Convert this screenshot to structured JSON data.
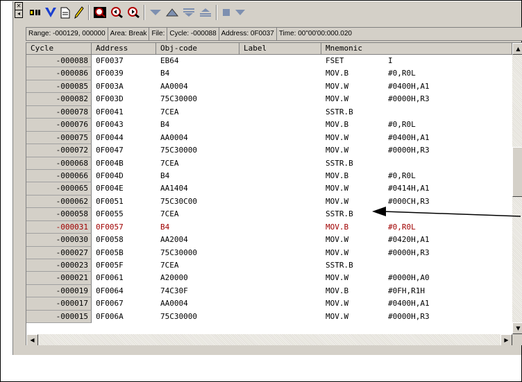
{
  "range_bar": {
    "range": "Range: -000129, 000000",
    "area": "Area: Break",
    "file": "File:",
    "cycle": "Cycle: -000088",
    "address": "Address: 0F0037",
    "time": "Time: 00\"00'00:000.020"
  },
  "columns": [
    "Cycle",
    "Address",
    "Obj-code",
    "Label",
    "Mnemonic"
  ],
  "rows": [
    {
      "cycle": "-000088",
      "address": "0F0037",
      "obj": "EB64",
      "label": "",
      "mnemonic": "FSET",
      "operand": "I"
    },
    {
      "cycle": "-000086",
      "address": "0F0039",
      "obj": "B4",
      "label": "",
      "mnemonic": "MOV.B",
      "operand": "#0,R0L"
    },
    {
      "cycle": "-000085",
      "address": "0F003A",
      "obj": "AA0004",
      "label": "",
      "mnemonic": "MOV.W",
      "operand": "#0400H,A1"
    },
    {
      "cycle": "-000082",
      "address": "0F003D",
      "obj": "75C30000",
      "label": "",
      "mnemonic": "MOV.W",
      "operand": "#0000H,R3"
    },
    {
      "cycle": "-000078",
      "address": "0F0041",
      "obj": "7CEA",
      "label": "",
      "mnemonic": "SSTR.B",
      "operand": ""
    },
    {
      "cycle": "-000076",
      "address": "0F0043",
      "obj": "B4",
      "label": "",
      "mnemonic": "MOV.B",
      "operand": "#0,R0L"
    },
    {
      "cycle": "-000075",
      "address": "0F0044",
      "obj": "AA0004",
      "label": "",
      "mnemonic": "MOV.W",
      "operand": "#0400H,A1"
    },
    {
      "cycle": "-000072",
      "address": "0F0047",
      "obj": "75C30000",
      "label": "",
      "mnemonic": "MOV.W",
      "operand": "#0000H,R3"
    },
    {
      "cycle": "-000068",
      "address": "0F004B",
      "obj": "7CEA",
      "label": "",
      "mnemonic": "SSTR.B",
      "operand": ""
    },
    {
      "cycle": "-000066",
      "address": "0F004D",
      "obj": "B4",
      "label": "",
      "mnemonic": "MOV.B",
      "operand": "#0,R0L"
    },
    {
      "cycle": "-000065",
      "address": "0F004E",
      "obj": "AA1404",
      "label": "",
      "mnemonic": "MOV.W",
      "operand": "#0414H,A1"
    },
    {
      "cycle": "-000062",
      "address": "0F0051",
      "obj": "75C30C00",
      "label": "",
      "mnemonic": "MOV.W",
      "operand": "#000CH,R3"
    },
    {
      "cycle": "-000058",
      "address": "0F0055",
      "obj": "7CEA",
      "label": "",
      "mnemonic": "SSTR.B",
      "operand": ""
    },
    {
      "cycle": "-000031",
      "address": "0F0057",
      "obj": "B4",
      "label": "",
      "mnemonic": "MOV.B",
      "operand": "#0,R0L",
      "highlight": true
    },
    {
      "cycle": "-000030",
      "address": "0F0058",
      "obj": "AA2004",
      "label": "",
      "mnemonic": "MOV.W",
      "operand": "#0420H,A1"
    },
    {
      "cycle": "-000027",
      "address": "0F005B",
      "obj": "75C30000",
      "label": "",
      "mnemonic": "MOV.W",
      "operand": "#0000H,R3"
    },
    {
      "cycle": "-000023",
      "address": "0F005F",
      "obj": "7CEA",
      "label": "",
      "mnemonic": "SSTR.B",
      "operand": ""
    },
    {
      "cycle": "-000021",
      "address": "0F0061",
      "obj": "A20000",
      "label": "",
      "mnemonic": "MOV.W",
      "operand": "#0000H,A0"
    },
    {
      "cycle": "-000019",
      "address": "0F0064",
      "obj": "74C30F",
      "label": "",
      "mnemonic": "MOV.B",
      "operand": "#0FH,R1H"
    },
    {
      "cycle": "-000017",
      "address": "0F0067",
      "obj": "AA0004",
      "label": "",
      "mnemonic": "MOV.W",
      "operand": "#0400H,A1"
    },
    {
      "cycle": "-000015",
      "address": "0F006A",
      "obj": "75C30000",
      "label": "",
      "mnemonic": "MOV.W",
      "operand": "#0000H,R3"
    }
  ],
  "colors": {
    "highlight": "#a00000",
    "window": "#d4d0c8",
    "toolbar_blue": "#1a3fd0",
    "toolbar_red": "#b00000"
  },
  "toolbar_icons": [
    "close-icon",
    "pin-icon",
    "record-icon",
    "filter-icon",
    "document-icon",
    "pencil-icon",
    "search-icon",
    "search-back-icon",
    "search-forward-icon",
    "down-arrow-icon",
    "up-arrow-icon",
    "step-down-icon",
    "step-top-icon",
    "stop-icon",
    "dropdown-icon"
  ]
}
